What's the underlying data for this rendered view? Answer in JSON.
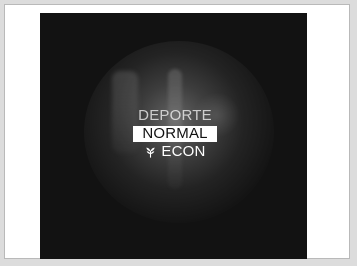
{
  "modes": {
    "deporte": "DEPORTE",
    "normal": "NORMAL",
    "econ": "ECON"
  },
  "icons": {
    "econ": "leaf-icon"
  },
  "colors": {
    "background": "#121212",
    "selection_background": "#ffffff",
    "selection_text": "#111111"
  }
}
